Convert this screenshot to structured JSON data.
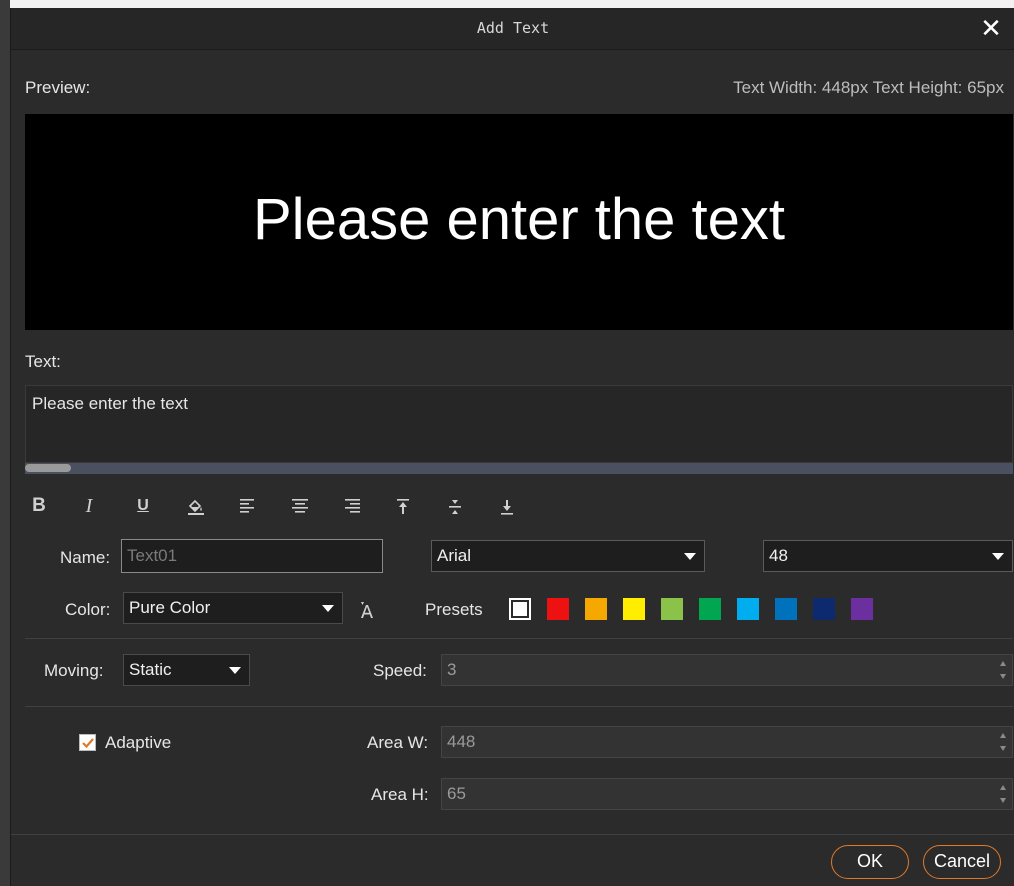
{
  "dialog": {
    "title": "Add Text",
    "close_glyph": "✕"
  },
  "preview": {
    "label": "Preview:",
    "info": "Text Width: 448px Text Height: 65px",
    "sample_text": "Please enter the text",
    "background": "#000000",
    "text_color": "#ffffff"
  },
  "text_section": {
    "label": "Text:",
    "value": "Please enter the text"
  },
  "toolbar": {
    "bold": "B",
    "italic": "I",
    "underline": "U",
    "icons": [
      "bold-icon",
      "italic-icon",
      "underline-icon",
      "fill-color-icon",
      "align-left-icon",
      "align-center-icon",
      "align-right-icon",
      "valign-top-icon",
      "valign-middle-icon",
      "valign-bottom-icon"
    ]
  },
  "name_field": {
    "label": "Name:",
    "placeholder": "Text01"
  },
  "font_select": {
    "value": "Arial"
  },
  "size_select": {
    "value": "48"
  },
  "color_field": {
    "label": "Color:",
    "value": "Pure Color",
    "presets_label": "Presets",
    "presets": [
      "#ffffff",
      "#ee1111",
      "#f5a800",
      "#ffee00",
      "#8bc34a",
      "#00a650",
      "#00aeef",
      "#0072bc",
      "#0d2a6e",
      "#6b2fa0"
    ]
  },
  "moving": {
    "label": "Moving:",
    "value": "Static"
  },
  "speed": {
    "label": "Speed:",
    "value": "3"
  },
  "adaptive": {
    "label": "Adaptive",
    "checked": true
  },
  "area_w": {
    "label": "Area W:",
    "value": "448"
  },
  "area_h": {
    "label": "Area H:",
    "value": "65"
  },
  "buttons": {
    "ok": "OK",
    "cancel": "Cancel"
  },
  "colors": {
    "accent": "#e07a2a",
    "dialog_bg": "#2b2b2b",
    "checkbox_mark": "#e07a2a"
  }
}
